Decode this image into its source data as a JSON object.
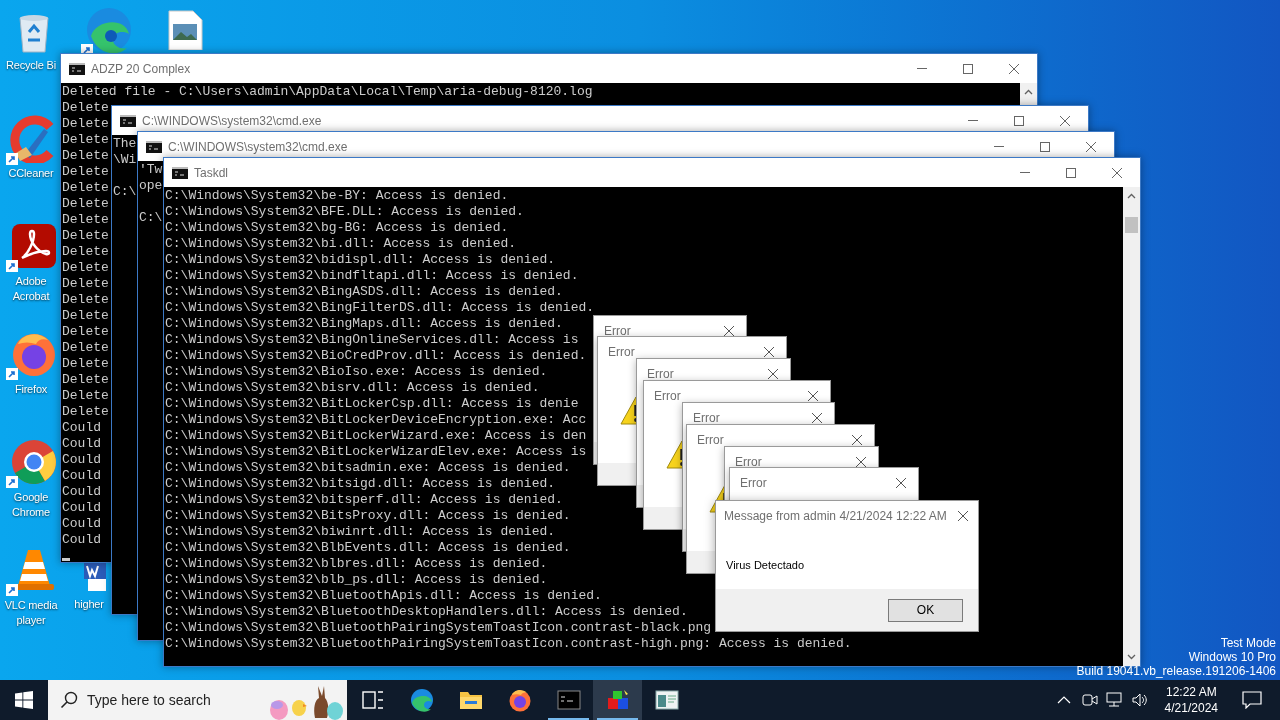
{
  "desktop_icons": [
    {
      "kind": "recycle-bin",
      "label": "Recycle Bi",
      "shortcut": false
    },
    {
      "kind": "edge",
      "shortcut": true
    },
    {
      "kind": "image-file",
      "shortcut": false
    },
    {
      "kind": "ccleaner",
      "label": "CCleaner",
      "shortcut": true
    },
    {
      "kind": "acrobat",
      "label": "Adobe Acrobat",
      "shortcut": true
    },
    {
      "kind": "firefox",
      "label": "Firefox",
      "shortcut": true
    },
    {
      "kind": "chrome",
      "label": "Google Chrome",
      "shortcut": true
    },
    {
      "kind": "vlc",
      "label": "VLC media player",
      "shortcut": true
    },
    {
      "kind": "word",
      "label": "higher",
      "shortcut": false
    }
  ],
  "windows": [
    {
      "title": "ADZP 20 Complex",
      "scrollbar": true,
      "lines": [
        "Deleted file - C:\\Users\\admin\\AppData\\Local\\Temp\\aria-debug-8120.log",
        "Delete",
        "Delete",
        "Delete",
        "Delete",
        "Delete",
        "Delete",
        "Delete",
        "Delete",
        "Delete",
        "Delete",
        "Delete",
        "Delete",
        "Delete",
        "Delete",
        "Delete",
        "Delete",
        "Delete",
        "Delete",
        "Delete",
        "Delete",
        "Could",
        "Could",
        "Could",
        "Could",
        "Could",
        "Could",
        "Could",
        "Could"
      ],
      "cursor": true
    },
    {
      "title": "C:\\WINDOWS\\system32\\cmd.exe",
      "scrollbar": false,
      "lines": [
        "The",
        "\\Wi"
      ],
      "prompt": "C:\\",
      "cursor": false
    },
    {
      "title": "C:\\WINDOWS\\system32\\cmd.exe",
      "scrollbar": false,
      "lines": [
        "'Tw",
        "ope"
      ],
      "prompt": "C:\\",
      "cursor": false
    },
    {
      "title": "Taskdl",
      "scrollbar": true,
      "cursor": false,
      "lines": [
        "C:\\Windows\\System32\\be-BY: Access is denied.",
        "C:\\Windows\\System32\\BFE.DLL: Access is denied.",
        "C:\\Windows\\System32\\bg-BG: Access is denied.",
        "C:\\Windows\\System32\\bi.dll: Access is denied.",
        "C:\\Windows\\System32\\bidispl.dll: Access is denied.",
        "C:\\Windows\\System32\\bindfltapi.dll: Access is denied.",
        "C:\\Windows\\System32\\BingASDS.dll: Access is denied.",
        "C:\\Windows\\System32\\BingFilterDS.dll: Access is denied.",
        "C:\\Windows\\System32\\BingMaps.dll: Access is denied.",
        "C:\\Windows\\System32\\BingOnlineServices.dll: Access is",
        "C:\\Windows\\System32\\BioCredProv.dll: Access is denied.",
        "C:\\Windows\\System32\\BioIso.exe: Access is denied.",
        "C:\\Windows\\System32\\bisrv.dll: Access is denied.",
        "C:\\Windows\\System32\\BitLockerCsp.dll: Access is denie",
        "C:\\Windows\\System32\\BitLockerDeviceEncryption.exe: Acc",
        "C:\\Windows\\System32\\BitLockerWizard.exe: Access is den",
        "C:\\Windows\\System32\\BitLockerWizardElev.exe: Access is",
        "C:\\Windows\\System32\\bitsadmin.exe: Access is denied.",
        "C:\\Windows\\System32\\bitsigd.dll: Access is denied.",
        "C:\\Windows\\System32\\bitsperf.dll: Access is denied.",
        "C:\\Windows\\System32\\BitsProxy.dll: Access is denied.",
        "C:\\Windows\\System32\\biwinrt.dll: Access is denied.",
        "C:\\Windows\\System32\\BlbEvents.dll: Access is denied.",
        "C:\\Windows\\System32\\blbres.dll: Access is denied.",
        "C:\\Windows\\System32\\blb_ps.dll: Access is denied.",
        "C:\\Windows\\System32\\BluetoothApis.dll: Access is denied.",
        "C:\\Windows\\System32\\BluetoothDesktopHandlers.dll: Access is denied.",
        "C:\\Windows\\System32\\BluetoothPairingSystemToastIcon.contrast-black.png",
        "C:\\Windows\\System32\\BluetoothPairingSystemToastIcon.contrast-high.png: Access is denied."
      ]
    }
  ],
  "error_dialogs": [
    {
      "title": "Error",
      "kind": "plain"
    },
    {
      "title": "Error",
      "kind": "warning"
    },
    {
      "title": "Error",
      "kind": "plain"
    },
    {
      "title": "Error",
      "kind": "warning"
    },
    {
      "title": "Error",
      "kind": "plain"
    },
    {
      "title": "Error",
      "kind": "warning"
    },
    {
      "title": "Error",
      "kind": "plain"
    },
    {
      "title": "Error",
      "kind": "plain"
    }
  ],
  "message_box": {
    "title": "Message from admin 4/21/2024 12:22 AM",
    "text": "Virus Detectado",
    "button": "OK"
  },
  "watermark": [
    "Test Mode",
    "Windows 10 Pro",
    "Build 19041.vb_release.191206-1406"
  ],
  "taskbar": {
    "search_placeholder": "Type here to search",
    "apps": [
      {
        "kind": "task-view",
        "running": false,
        "selected": false
      },
      {
        "kind": "edge",
        "running": false,
        "selected": false
      },
      {
        "kind": "explorer",
        "running": false,
        "selected": false
      },
      {
        "kind": "firefox",
        "running": false,
        "selected": false
      },
      {
        "kind": "console",
        "running": true,
        "selected": false
      },
      {
        "kind": "cubes",
        "running": true,
        "selected": true
      },
      {
        "kind": "window-app",
        "running": false,
        "selected": false
      }
    ],
    "time": "12:22 AM",
    "date": "4/21/2024"
  }
}
